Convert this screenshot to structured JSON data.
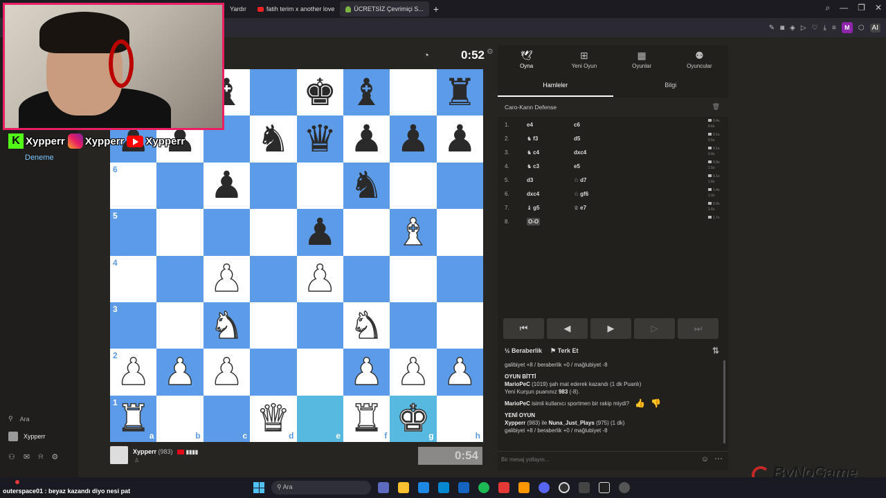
{
  "browser": {
    "tabs": [
      {
        "label": "Yardır",
        "icon": "tab-icon"
      },
      {
        "label": "fatih terim x another love",
        "icon": "youtube-icon"
      },
      {
        "label": "ÜCRETSİZ Çevrimiçi S...",
        "icon": "lichess-pawn-icon",
        "active": true
      }
    ],
    "new_tab": "+"
  },
  "stream_overlay": {
    "handle_kick": "Xypperr",
    "handle_instagram": "Xypperr",
    "handle_youtube": "Xypperr"
  },
  "sidebar": {
    "deneme": "Deneme",
    "search_label": "Ara",
    "user_label": "Xypperr"
  },
  "opponent": {
    "timer": "0:52"
  },
  "board": {
    "files": [
      "a",
      "b",
      "c",
      "d",
      "e",
      "f",
      "g",
      "h"
    ],
    "ranks": [
      "6",
      "5",
      "4",
      "3",
      "2",
      "1"
    ],
    "position": [
      [
        "",
        "",
        "bB",
        "",
        "bK",
        "bB",
        "",
        "bR"
      ],
      [
        "bP",
        "bP",
        "",
        "bN",
        "bQ",
        "bP",
        "bP",
        "bP"
      ],
      [
        "",
        "",
        "bP",
        "",
        "",
        "bN",
        "",
        ""
      ],
      [
        "",
        "",
        "",
        "",
        "bP",
        "",
        "wB",
        ""
      ],
      [
        "",
        "",
        "wP",
        "",
        "wP",
        "",
        "",
        ""
      ],
      [
        "",
        "",
        "wN",
        "",
        "",
        "wN",
        "",
        ""
      ],
      [
        "wP",
        "wP",
        "wP",
        "",
        "",
        "wP",
        "wP",
        "wP"
      ],
      [
        "wR",
        "",
        "",
        "wQ",
        "",
        "wR",
        "wK",
        ""
      ]
    ],
    "highlight_squares": [
      "e1",
      "g1"
    ]
  },
  "player": {
    "name": "Xypperr",
    "rating": "(983)",
    "bars": "▮▮▮▮",
    "timer": "0:54"
  },
  "panel": {
    "tabs": [
      {
        "label": "Oyna",
        "icon": "play-rocket-icon",
        "active": true
      },
      {
        "label": "Yeni Oyun",
        "icon": "plus-square-icon"
      },
      {
        "label": "Oyunlar",
        "icon": "board-icon"
      },
      {
        "label": "Oyuncular",
        "icon": "players-icon"
      }
    ],
    "subtabs": [
      {
        "label": "Hamleler",
        "active": true
      },
      {
        "label": "Bilgi"
      }
    ],
    "opening": "Caro-Kann Defense",
    "moves": [
      {
        "num": "1.",
        "white": "e4",
        "black": "c6",
        "wt": "0.4s",
        "bt": "0.6s"
      },
      {
        "num": "2.",
        "white": "f3",
        "wp": "♞",
        "black": "d5",
        "wt": "0.1s",
        "bt": "0.5s"
      },
      {
        "num": "3.",
        "white": "c4",
        "wp": "♞",
        "black": "dxc4",
        "wt": "0.1s",
        "bt": "0.8s"
      },
      {
        "num": "4.",
        "white": "c3",
        "wp": "♞",
        "black": "e5",
        "wt": "0.9s",
        "bt": "1.5s"
      },
      {
        "num": "5.",
        "white": "d3",
        "black": "d7",
        "bp": "♘",
        "wt": "0.1s",
        "bt": "1.8s"
      },
      {
        "num": "6.",
        "white": "dxc4",
        "black": "gf6",
        "bp": "♘",
        "wt": "1.4s",
        "bt": "1.0s"
      },
      {
        "num": "7.",
        "white": "g5",
        "wp": "♝",
        "black": "e7",
        "bp": "♕",
        "wt": "0.9s",
        "bt": "1.6s"
      },
      {
        "num": "8.",
        "white": "O-O",
        "black": "",
        "wt": "1.7s",
        "bt": ""
      }
    ],
    "nav": [
      "⏮",
      "◀",
      "▶",
      "▶",
      "⏭"
    ],
    "draw_label": "Beraberlik",
    "resign_label": "Terk Et",
    "chat": {
      "line1": "galibiyet +8 / beraberlik +0 / mağlubiyet -8",
      "over_title": "OYUN BİTTİ",
      "over_player": "MarioPeC",
      "over_text": " (1019) şah mat ederek kazandı (1 dk Puanlı)",
      "new_rating_text": "Yeni Kurşun puanınız ",
      "new_rating_value": "983",
      "new_rating_delta": " (-8).",
      "sporty_player": "MarioPeC",
      "sporty_text": " isimli kullanıcı sportmen bir rakip miydi?",
      "new_game_title": "YENİ OYUN",
      "ng_p1": "Xypperr",
      "ng_mid": " (983) ile ",
      "ng_p2": "Nuna_Just_Plays",
      "ng_tail": " (975) (1 dk)",
      "line_last": "galibiyet +8 / beraberlik +0 / mağlubiyet -8"
    },
    "chat_placeholder": "Bir mesaj yollayın..."
  },
  "taskbar": {
    "chat_user": "outerspace01",
    "chat_text": " : beyaz kazandı diyo nesi pat",
    "search": "Ara"
  },
  "watermark": "ByNoGame",
  "colors": {
    "light_square": "#ffffff",
    "dark_square": "#5c9be8",
    "highlight": "#57b9e0",
    "accent_pink": "#e91e63"
  }
}
